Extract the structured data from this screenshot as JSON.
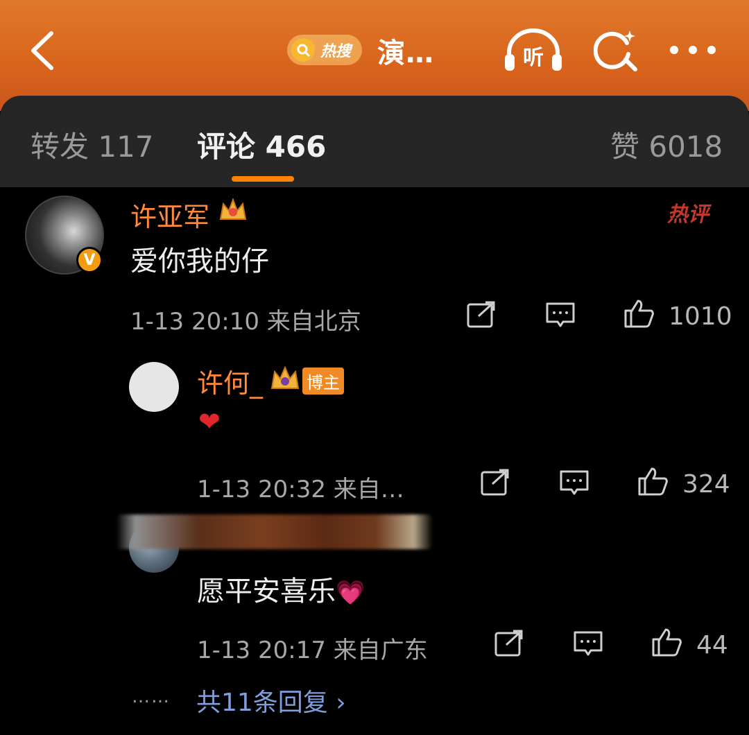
{
  "header": {
    "hot_search_label": "热搜",
    "title": "演…",
    "listen_label": "听"
  },
  "tabs": [
    {
      "label": "转发 117"
    },
    {
      "label": "评论 466"
    },
    {
      "label": "赞 6018"
    }
  ],
  "hot_comment_badge": "热评",
  "comments": [
    {
      "user": "许亚军",
      "text": "爱你我的仔",
      "time": "1-13 20:10",
      "location": "来自北京",
      "likes": "1010"
    }
  ],
  "replies": [
    {
      "user": "许何_",
      "tag": "博主",
      "text": "❤",
      "time": "1-13 20:32",
      "location": "来自…",
      "likes": "324"
    },
    {
      "user": "",
      "text": "愿平安喜乐",
      "time": "1-13 20:17",
      "location": "来自广东",
      "likes": "44"
    }
  ],
  "more_replies": {
    "dots": "……",
    "label": "共11条回复 ›"
  },
  "colors": {
    "accent": "#ff8200",
    "username": "#ff8a3d",
    "link": "#7f9fdc",
    "header": "#d8641c"
  }
}
